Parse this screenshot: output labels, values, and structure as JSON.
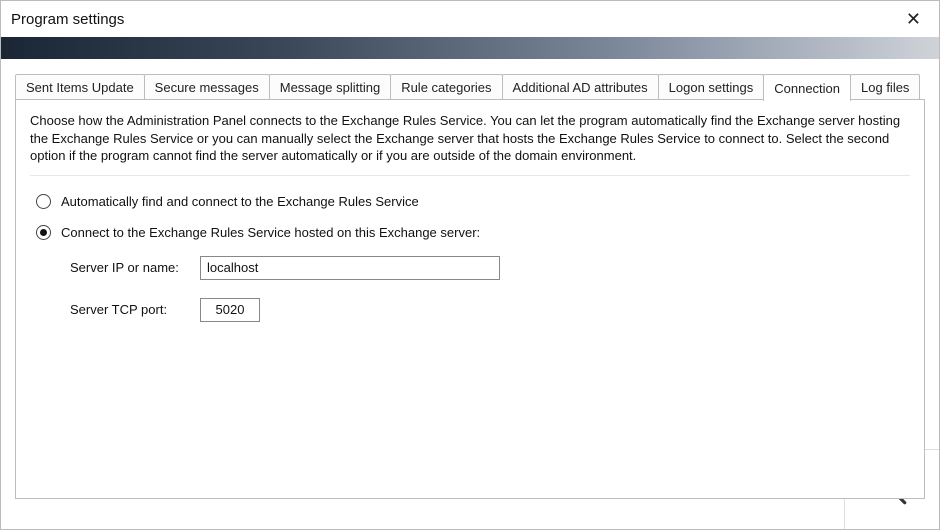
{
  "window": {
    "title": "Program settings"
  },
  "tabs": [
    {
      "label": "Sent Items Update"
    },
    {
      "label": "Secure messages"
    },
    {
      "label": "Message splitting"
    },
    {
      "label": "Rule categories"
    },
    {
      "label": "Additional AD attributes"
    },
    {
      "label": "Logon settings"
    },
    {
      "label": "Connection"
    },
    {
      "label": "Log files"
    }
  ],
  "panel": {
    "description": "Choose how the Administration Panel connects to the Exchange Rules Service. You can let the program automatically find the Exchange server hosting the Exchange Rules Service or you can manually select the Exchange server that hosts the Exchange Rules Service to connect to. Select the second option if the program cannot find the server automatically or if you are outside of the domain environment.",
    "option_auto": "Automatically find and connect to the Exchange Rules Service",
    "option_manual": "Connect to the Exchange Rules Service hosted on this Exchange server:",
    "server_name_label": "Server IP or name:",
    "server_name_value": "localhost",
    "server_port_label": "Server TCP port:",
    "server_port_value": "5020"
  }
}
